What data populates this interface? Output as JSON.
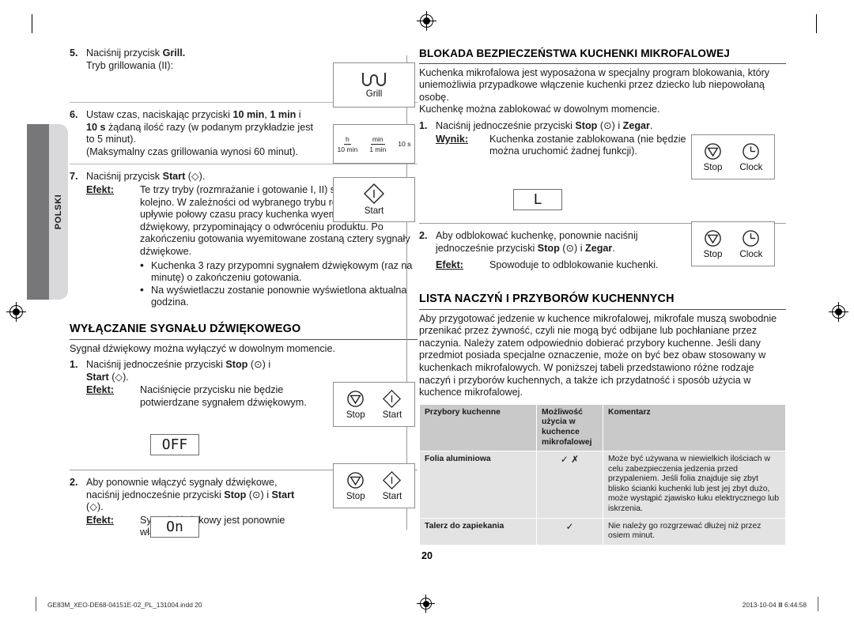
{
  "side_tab": {
    "label": "POLSKI"
  },
  "page_number": "20",
  "footer": {
    "file": "GE83M_XEO-DE68-04151E-02_PL_131004.indd   20",
    "timestamp": "2013-10-04   Ⅲ 6:44:58"
  },
  "left_column": {
    "step5": {
      "num": "5.",
      "line1_pre": "Naciśnij przycisk ",
      "line1_bold": "Grill.",
      "line2": "Tryb grillowania (II):",
      "keybox": {
        "glyph": "grill-icon",
        "caption": "Grill"
      }
    },
    "step6": {
      "num": "6.",
      "text_a": "Ustaw czas, naciskając przyciski ",
      "bold_a": "10 min",
      "text_b": ", ",
      "bold_b": "1 min",
      "text_c": " i ",
      "bold_c": "10 s",
      "text_d": " żądaną ilość razy (w podanym przykładzie jest to 5 minut).",
      "line2": "(Maksymalny czas grillowania wynosi 60 minut).",
      "timeset": {
        "k1_top": "h",
        "k1_bot": "10 min",
        "k2_top": "min",
        "k2_bot": "1 min",
        "k3": "10 s"
      }
    },
    "step7": {
      "num": "7.",
      "text_pre": "Naciśnij przycisk ",
      "bold": "Start",
      "text_post": " (◇).",
      "effect_label": "Efekt:",
      "effect_text": "Te trzy tryby (rozmrażanie i gotowanie I, II) są włączane kolejno. W zależności od wybranego trybu rozmrażania po upływie połowy czasu pracy kuchenka wyemituje sygnał dźwiękowy, przypominający o odwróceniu produktu. Po zakończeniu gotowania wyemitowane zostaną cztery sygnały dźwiękowe.",
      "bullets": [
        "Kuchenka 3 razy przypomni sygnałem dźwiękowym (raz na minutę) o zakończeniu gotowania.",
        "Na wyświetlaczu zostanie ponownie wyświetlona aktualna godzina."
      ],
      "keybox": {
        "glyph": "start-icon",
        "caption": "Start"
      }
    },
    "beep_section": {
      "title": "WYŁĄCZANIE SYGNAŁU DŹWIĘKOWEGO",
      "intro": "Sygnał dźwiękowy można wyłączyć w dowolnym momencie.",
      "step1": {
        "num": "1.",
        "text_pre": "Naciśnij jednocześnie przyciski ",
        "bold_stop": "Stop",
        "text_mid": " (⊙) i",
        "bold_start": "Start",
        "text_post": " (◇).",
        "effect_label": "Efekt:",
        "effect_text": "Naciśnięcie przycisku nie będzie potwierdzane sygnałem dźwiękowym.",
        "lcd": "OFF",
        "keybox": {
          "k1": "Stop",
          "k2": "Start"
        }
      },
      "step2": {
        "num": "2.",
        "text_pre": "Aby ponownie włączyć sygnały dźwiękowe, naciśnij jednocześnie przyciski ",
        "bold_stop": "Stop",
        "text_mid": " (⊙) i ",
        "bold_start": "Start",
        "text_post": " (◇).",
        "effect_label": "Efekt:",
        "effect_text": "Sygnał dźwiękowy jest ponownie włączony.",
        "lcd": "On",
        "keybox": {
          "k1": "Stop",
          "k2": "Start"
        }
      }
    }
  },
  "right_column": {
    "lock_section": {
      "title": "BLOKADA BEZPIECZEŃSTWA KUCHENKI MIKROFALOWEJ",
      "intro1": "Kuchenka mikrofalowa jest wyposażona w specjalny program blokowania, który uniemożliwia przypadkowe włączenie kuchenki przez dziecko lub niepowołaną osobę.",
      "intro2": "Kuchenkę można zablokować w dowolnym momencie.",
      "step1": {
        "num": "1.",
        "text_pre": "Naciśnij jednocześnie przyciski ",
        "bold_stop": "Stop",
        "text_mid": " (⊙) i ",
        "bold_clock": "Zegar",
        "text_post": ".",
        "effect_label": "Wynik:",
        "effect_text": "Kuchenka zostanie zablokowana (nie będzie można uruchomić żadnej funkcji).",
        "lcd": "L",
        "keybox": {
          "k1": "Stop",
          "k2": "Clock"
        }
      },
      "step2": {
        "num": "2.",
        "text_pre": "Aby odblokować kuchenkę, ponownie naciśnij jednocześnie przyciski ",
        "bold_stop": "Stop",
        "text_mid": " (⊙) i ",
        "bold_clock": "Zegar",
        "text_post": ".",
        "effect_label": "Efekt:",
        "effect_text": "Spowoduje to odblokowanie kuchenki.",
        "keybox": {
          "k1": "Stop",
          "k2": "Clock"
        }
      }
    },
    "utensils_section": {
      "title": "LISTA NACZYŃ I PRZYBORÓW KUCHENNYCH",
      "intro": "Aby przygotować jedzenie w kuchence mikrofalowej, mikrofale muszą swobodnie przenikać przez żywność, czyli nie mogą być odbijane lub pochłaniane przez naczynia. Należy zatem odpowiednio dobierać przybory kuchenne. Jeśli dany przedmiot posiada specjalne oznaczenie, może on być bez obaw stosowany w kuchenkach mikrofalowych. W poniższej tabeli przedstawiono różne rodzaje naczyń i przyborów kuchennych, a także ich przydatność i sposób użycia w kuchence mikrofalowej.",
      "table": {
        "headers": [
          "Przybory kuchenne",
          "Możliwość użycia w kuchence mikrofalowej",
          "Komentarz"
        ],
        "rows": [
          {
            "name": "Folia aluminiowa",
            "mark": "✓ ✗",
            "comment": "Może być używana w niewielkich ilościach w celu zabezpieczenia jedzenia przed przypaleniem. Jeśli folia znajduje się zbyt blisko ścianki kuchenki lub jest jej zbyt dużo, może wystąpić zjawisko łuku elektrycznego lub iskrzenia."
          },
          {
            "name": "Talerz do zapiekania",
            "mark": "✓",
            "comment": "Nie należy go rozgrzewać dłużej niż przez osiem minut."
          }
        ]
      }
    }
  }
}
